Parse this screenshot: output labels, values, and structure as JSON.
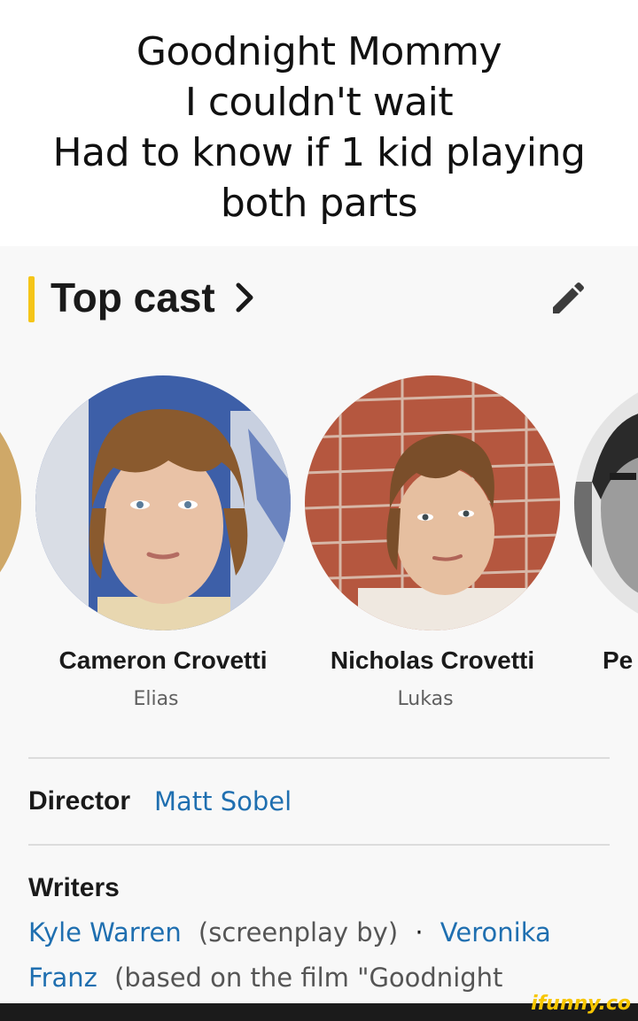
{
  "meme_caption": {
    "line1": "Goodnight Mommy",
    "line2": "I couldn't wait",
    "line3": "Had to know if 1 kid playing",
    "line4": "both parts"
  },
  "section": {
    "title": "Top cast",
    "accent_color": "#f5c518",
    "chevron_icon": "chevron-right-icon",
    "edit_icon": "pencil-icon"
  },
  "cast": [
    {
      "name": "Cameron Crovetti",
      "role": "Elias"
    },
    {
      "name": "Nicholas Crovetti",
      "role": "Lukas"
    },
    {
      "name": "Pe",
      "role": ""
    }
  ],
  "credits": {
    "director_label": "Director",
    "director_name": "Matt Sobel",
    "writers_label": "Writers",
    "writer1_name": "Kyle Warren",
    "writer1_note": "(screenplay by)",
    "separator": "·",
    "writer2_name_part1": "Veronika",
    "writer2_name_part2": "Franz",
    "writer2_note": "(based on the film \"Goodnight"
  },
  "watermark": "ifunny.co",
  "link_color": "#1f6fb0"
}
